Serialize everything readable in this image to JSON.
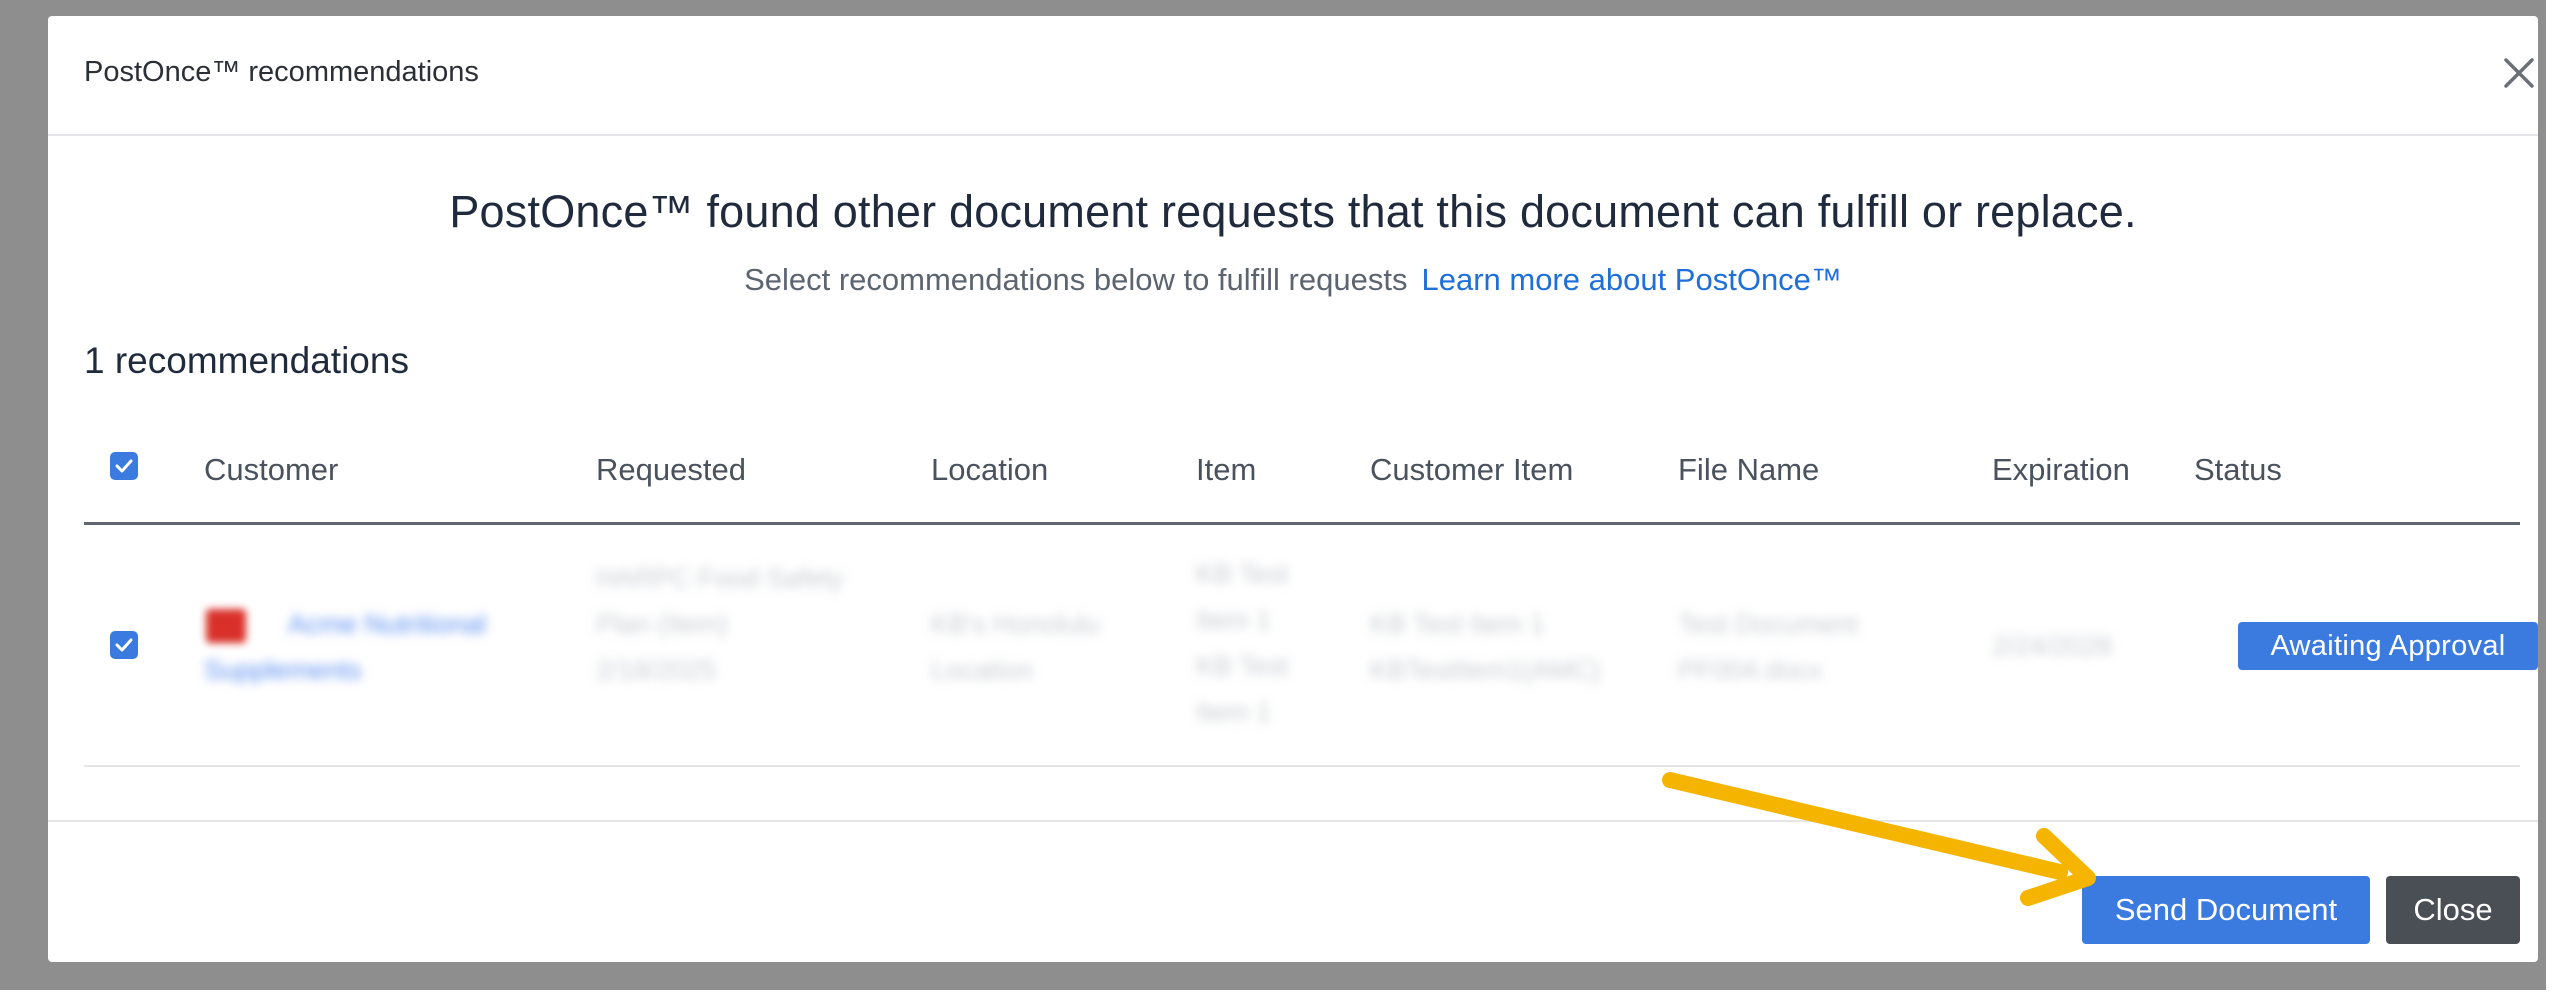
{
  "modal": {
    "title": "PostOnce™ recommendations",
    "headline": "PostOnce™ found other document requests that this document can fulfill or replace.",
    "subline": "Select recommendations below to fulfill requests",
    "learn_more": "Learn more about PostOnce™",
    "rec_count": "1 recommendations"
  },
  "table": {
    "columns": [
      "Customer",
      "Requested",
      "Location",
      "Item",
      "Customer Item",
      "File Name",
      "Expiration",
      "Status"
    ],
    "rows": [
      {
        "customer": [
          "Acme Nutritional",
          "Supplements"
        ],
        "requested": [
          "HARPC Food Safety",
          "Plan (Item)",
          "2/18/2025"
        ],
        "location": [
          "KB's Honolulu",
          "Location"
        ],
        "item": [
          "KB Test",
          "Item 1",
          "KB Test",
          "Item 1"
        ],
        "customer_item": [
          "KB Test Item 1",
          "KBTestItem1(AMC)"
        ],
        "file_name": [
          "Test Document",
          "PF004.docx"
        ],
        "expiration": "2/24/2028",
        "status": "Awaiting Approval"
      }
    ]
  },
  "footer": {
    "send_label": "Send Document",
    "close_label": "Close"
  },
  "colors": {
    "accent": "#3b7be0",
    "link": "#1e6fd9",
    "close_button": "#4a4f55",
    "annotation_arrow": "#f5b400"
  },
  "icons": {
    "close": "close-icon",
    "check": "check-icon",
    "arrow": "annotation-arrow"
  }
}
